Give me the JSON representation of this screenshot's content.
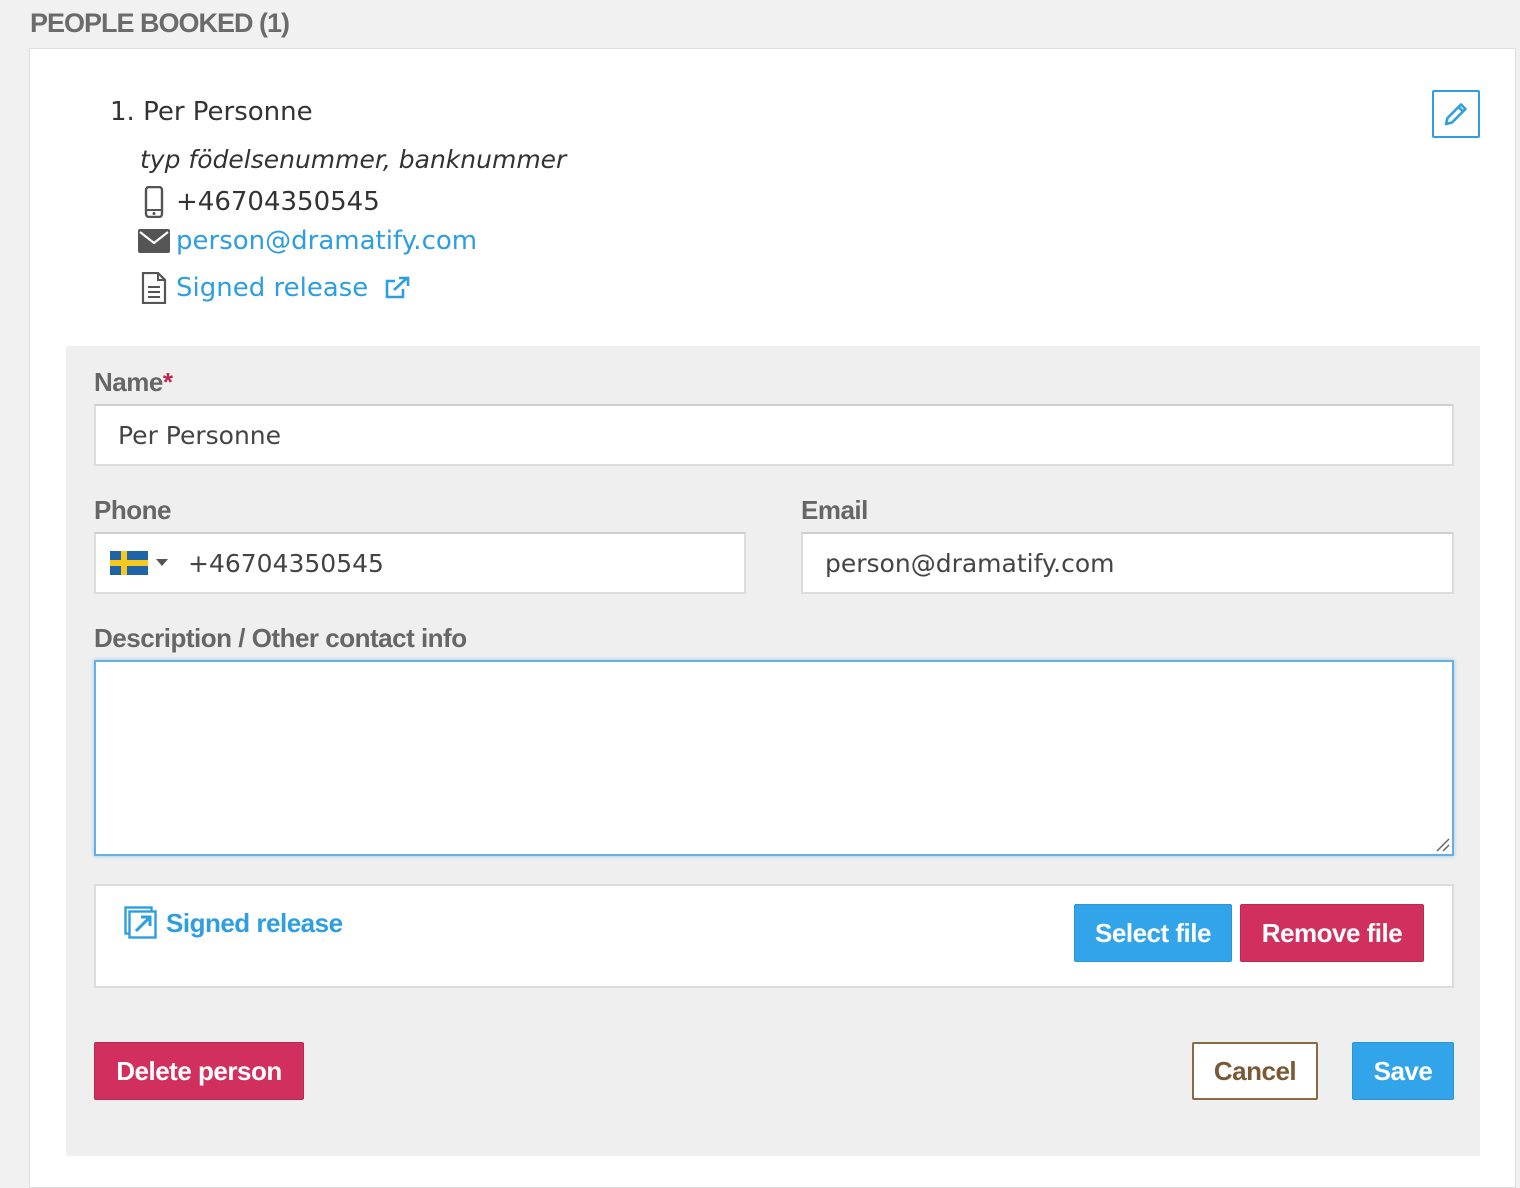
{
  "section": {
    "title": "PEOPLE BOOKED (1)"
  },
  "person": {
    "name_line": "1. Per Personne",
    "type_line": "typ födelsenummer, banknummer",
    "phone": "+46704350545",
    "email": "person@dramatify.com",
    "release_link": "Signed release",
    "icons": [
      "mobile-phone-icon",
      "envelope-icon",
      "document-icon",
      "external-link-icon",
      "pencil-icon"
    ]
  },
  "form": {
    "name_label": "Name",
    "required_mark": "*",
    "name_value": "Per Personne",
    "phone_label": "Phone",
    "phone_country_flag": "sweden-flag",
    "phone_value": "+46704350545",
    "email_label": "Email",
    "email_value": "person@dramatify.com",
    "description_label": "Description / Other contact info",
    "description_value": "",
    "file": {
      "link_label": "Signed release",
      "select_label": "Select file",
      "remove_label": "Remove file"
    },
    "actions": {
      "delete_label": "Delete person",
      "cancel_label": "Cancel",
      "save_label": "Save"
    }
  },
  "colors": {
    "accent_blue": "#32a4ea",
    "danger_red": "#d1305f",
    "cancel_brown": "#8a6a45",
    "link_blue": "#2d9ee0"
  }
}
